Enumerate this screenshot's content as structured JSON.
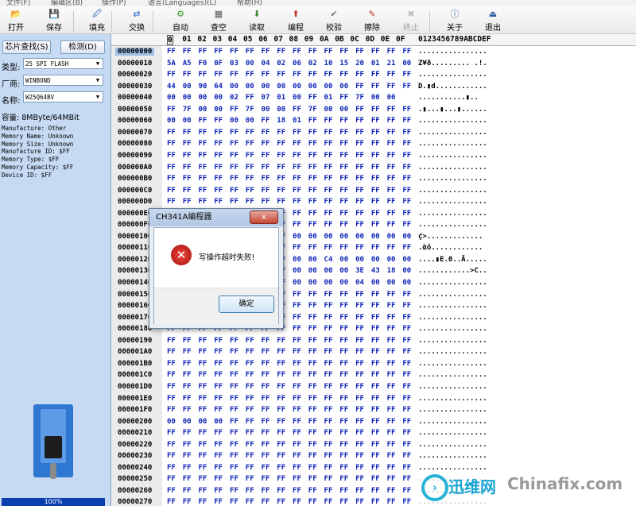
{
  "menu": [
    "文件(F)",
    "编辑区(B)",
    "操作(P)",
    "语言(Languages)(L)",
    "帮助(H)"
  ],
  "toolbar": [
    {
      "label": "打开",
      "icon": "open-folder-icon",
      "enabled": true
    },
    {
      "label": "保存",
      "icon": "save-disk-icon",
      "enabled": true
    },
    {
      "label": "填充",
      "icon": "fill-icon",
      "enabled": true
    },
    {
      "label": "交换",
      "icon": "swap-arrows-icon",
      "enabled": true
    },
    {
      "label": "自动",
      "icon": "auto-icon",
      "enabled": true
    },
    {
      "label": "查空",
      "icon": "blank-check-icon",
      "enabled": true
    },
    {
      "label": "读取",
      "icon": "read-icon",
      "enabled": true
    },
    {
      "label": "编程",
      "icon": "program-icon",
      "enabled": true
    },
    {
      "label": "校验",
      "icon": "verify-icon",
      "enabled": true
    },
    {
      "label": "擦除",
      "icon": "erase-icon",
      "enabled": true
    },
    {
      "label": "终止",
      "icon": "stop-icon",
      "enabled": false
    },
    {
      "label": "关于",
      "icon": "info-icon",
      "enabled": true
    },
    {
      "label": "退出",
      "icon": "exit-icon",
      "enabled": true
    }
  ],
  "left": {
    "find_chip": "芯片查找(S)",
    "detect": "检测(D)",
    "type_label": "类型:",
    "type_value": "25 SPI FLASH",
    "maker_label": "厂商:",
    "maker_value": "WINBOND",
    "name_label": "名称:",
    "name_value": "W25Q64BV",
    "capacity": "容量: 8MByte/64MBit",
    "info": [
      "Manufacture: Other",
      "Memory Name: Unknown",
      "Memory Size: Unknown",
      "Manufacture ID: $FF",
      "Memory Type: $FF",
      "Memory Capacity: $FF",
      "Device ID: $FF"
    ],
    "progress": "100%"
  },
  "hex": {
    "header_cols": [
      "0",
      "01",
      "02",
      "03",
      "04",
      "05",
      "06",
      "07",
      "08",
      "09",
      "0A",
      "0B",
      "0C",
      "0D",
      "0E",
      "0F"
    ],
    "ascii_header": "0123456789ABCDEF",
    "rows": [
      {
        "addr": "00000000",
        "bytes": "FF FF FF FF FF FF FF FF FF FF FF FF FF FF FF FF",
        "ascii": "................"
      },
      {
        "addr": "00000010",
        "bytes": "5A A5 F0 0F 03 00 04 02 06 02 10 15 20 01 21 00",
        "ascii": "Z¥ð......... .!."
      },
      {
        "addr": "00000020",
        "bytes": "FF FF FF FF FF FF FF FF FF FF FF FF FF FF FF FF",
        "ascii": "................"
      },
      {
        "addr": "00000030",
        "bytes": "44 00 90 64 00 00 00 00 00 00 00 00 FF FF FF FF",
        "ascii": "D.▮d............"
      },
      {
        "addr": "00000040",
        "bytes": "00 00 00 00 02 FF 07 01 00 FF 01 FF 7F 00 00",
        "ascii": "...........▮.."
      },
      {
        "addr": "00000050",
        "bytes": "FF 7F 00 00 FF 7F 00 00 FF 7F 00 00 FF FF FF FF",
        "ascii": ".▮...▮...▮......"
      },
      {
        "addr": "00000060",
        "bytes": "00 00 FF FF 00 00 FF 18 01 FF FF FF FF FF FF FF",
        "ascii": "................"
      },
      {
        "addr": "00000070",
        "bytes": "FF FF FF FF FF FF FF FF FF FF FF FF FF FF FF FF",
        "ascii": "................"
      },
      {
        "addr": "00000080",
        "bytes": "FF FF FF FF FF FF FF FF FF FF FF FF FF FF FF FF",
        "ascii": "................"
      },
      {
        "addr": "00000090",
        "bytes": "FF FF FF FF FF FF FF FF FF FF FF FF FF FF FF FF",
        "ascii": "................"
      },
      {
        "addr": "000000A0",
        "bytes": "FF FF FF FF FF FF FF FF FF FF FF FF FF FF FF FF",
        "ascii": "................"
      },
      {
        "addr": "000000B0",
        "bytes": "FF FF FF FF FF FF FF FF FF FF FF FF FF FF FF FF",
        "ascii": "................"
      },
      {
        "addr": "000000C0",
        "bytes": "FF FF FF FF FF FF FF FF FF FF FF FF FF FF FF FF",
        "ascii": "................"
      },
      {
        "addr": "000000D0",
        "bytes": "FF FF FF FF FF FF FF FF FF FF FF FF FF FF FF FF",
        "ascii": "................"
      },
      {
        "addr": "000000E0",
        "bytes": "FF FF FF FF FF FF FF FF FF FF FF FF FF FF FF FF",
        "ascii": "................"
      },
      {
        "addr": "000000F0",
        "bytes": "FF FF FF FF FF FF FF FF FF FF FF FF FF FF FF FF",
        "ascii": "................"
      },
      {
        "addr": "00000100",
        "bytes": "FF FF FF FF FF FF FF FF 00 00 00 00 00 00 00 00",
        "ascii": "ḉ>............."
      },
      {
        "addr": "00000110",
        "bytes": "FF FF FF FF FF FF FF FF FF FF FF FF FF FF FF FF",
        "ascii": ".ὰô............"
      },
      {
        "addr": "00000120",
        "bytes": "FF FF FF FF FF FF FF FF 00 00 C4 00 00 00 00 00",
        "ascii": "....▮E.0..Ä....."
      },
      {
        "addr": "00000130",
        "bytes": "FF FF FF FF FF FF FF FF 00 00 00 00 3E 43 18 00",
        "ascii": "............>C.."
      },
      {
        "addr": "00000140",
        "bytes": "FF FF FF FF FF FF FF FF 00 00 00 00 04 00 00 00",
        "ascii": "................"
      },
      {
        "addr": "00000150",
        "bytes": "FF FF FF FF FF FF FF FF FF FF FF FF FF FF FF FF",
        "ascii": "................"
      },
      {
        "addr": "00000160",
        "bytes": "FF FF FF FF FF FF FF FF FF FF FF FF FF FF FF FF",
        "ascii": "................"
      },
      {
        "addr": "00000170",
        "bytes": "FF FF FF FF FF FF FF FF FF FF FF FF FF FF FF FF",
        "ascii": "................"
      },
      {
        "addr": "00000180",
        "bytes": "FF FF FF FF FF FF FF FF FF FF FF FF FF FF FF FF",
        "ascii": "................"
      },
      {
        "addr": "00000190",
        "bytes": "FF FF FF FF FF FF FF FF FF FF FF FF FF FF FF FF",
        "ascii": "................"
      },
      {
        "addr": "000001A0",
        "bytes": "FF FF FF FF FF FF FF FF FF FF FF FF FF FF FF FF",
        "ascii": "................"
      },
      {
        "addr": "000001B0",
        "bytes": "FF FF FF FF FF FF FF FF FF FF FF FF FF FF FF FF",
        "ascii": "................"
      },
      {
        "addr": "000001C0",
        "bytes": "FF FF FF FF FF FF FF FF FF FF FF FF FF FF FF FF",
        "ascii": "................"
      },
      {
        "addr": "000001D0",
        "bytes": "FF FF FF FF FF FF FF FF FF FF FF FF FF FF FF FF",
        "ascii": "................"
      },
      {
        "addr": "000001E0",
        "bytes": "FF FF FF FF FF FF FF FF FF FF FF FF FF FF FF FF",
        "ascii": "................"
      },
      {
        "addr": "000001F0",
        "bytes": "FF FF FF FF FF FF FF FF FF FF FF FF FF FF FF FF",
        "ascii": "................"
      },
      {
        "addr": "00000200",
        "bytes": "00 00 00 00 FF FF FF FF FF FF FF FF FF FF FF FF",
        "ascii": "................"
      },
      {
        "addr": "00000210",
        "bytes": "FF FF FF FF FF FF FF FF FF FF FF FF FF FF FF FF",
        "ascii": "................"
      },
      {
        "addr": "00000220",
        "bytes": "FF FF FF FF FF FF FF FF FF FF FF FF FF FF FF FF",
        "ascii": "................"
      },
      {
        "addr": "00000230",
        "bytes": "FF FF FF FF FF FF FF FF FF FF FF FF FF FF FF FF",
        "ascii": "................"
      },
      {
        "addr": "00000240",
        "bytes": "FF FF FF FF FF FF FF FF FF FF FF FF FF FF FF FF",
        "ascii": "................"
      },
      {
        "addr": "00000250",
        "bytes": "FF FF FF FF FF FF FF FF FF FF FF FF FF FF FF FF",
        "ascii": "................"
      },
      {
        "addr": "00000260",
        "bytes": "FF FF FF FF FF FF FF FF FF FF FF FF FF FF FF FF",
        "ascii": "................"
      },
      {
        "addr": "00000270",
        "bytes": "FF FF FF FF FF FF FF FF FF FF FF FF FF FF FF FF",
        "ascii": "................"
      }
    ]
  },
  "dialog": {
    "title": "CH341A编程器",
    "close": "x",
    "message": "写操作超时失败!",
    "ok": "确定"
  },
  "watermark": {
    "cn": "迅维网",
    "en": "Chinafix.com"
  }
}
